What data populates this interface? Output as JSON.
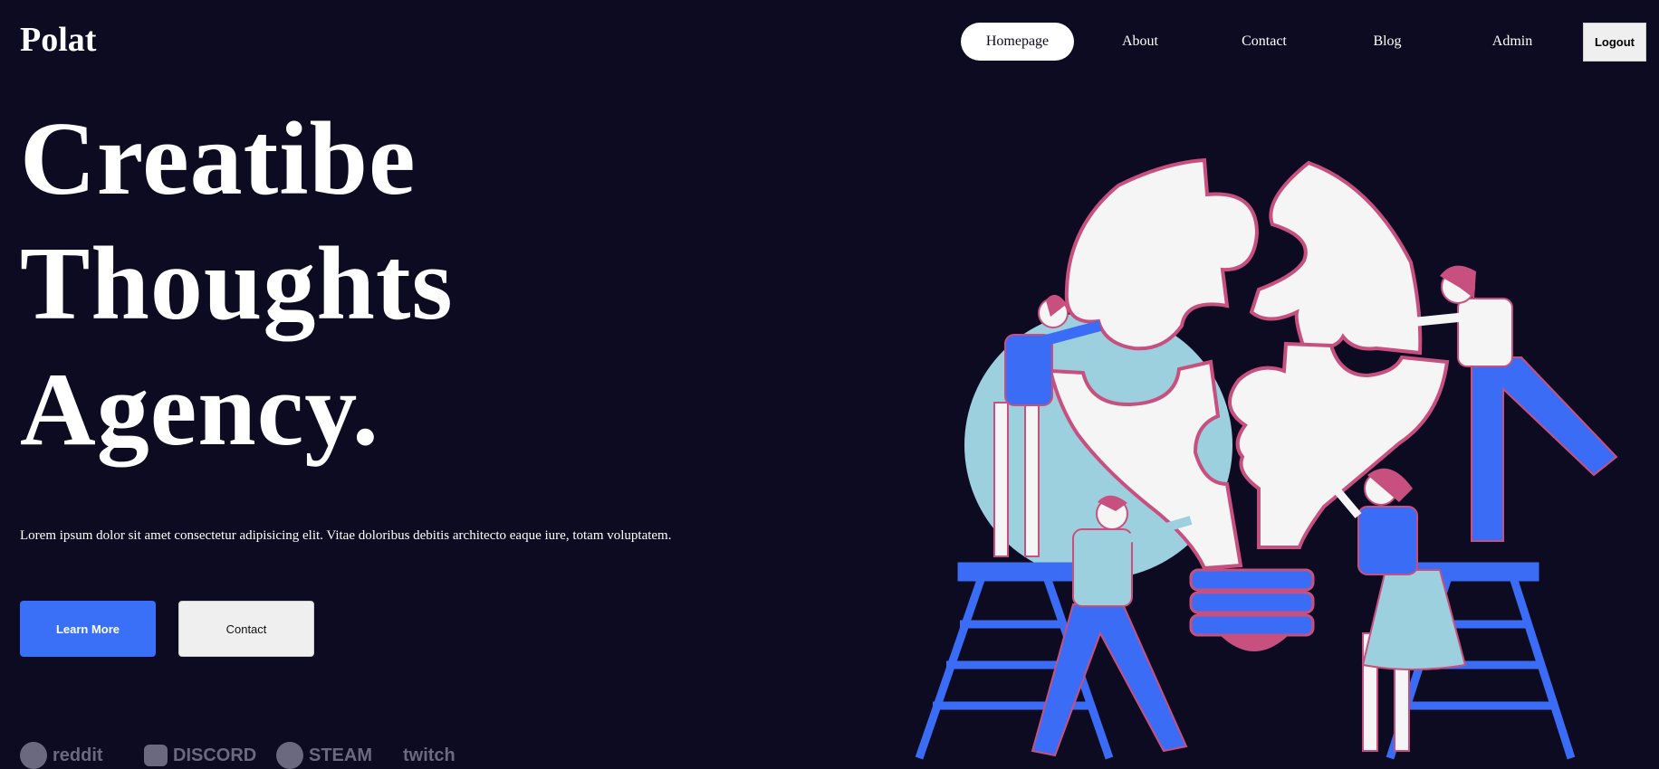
{
  "brand": {
    "logo": "Polat"
  },
  "nav": {
    "items": [
      {
        "label": "Homepage",
        "active": true
      },
      {
        "label": "About",
        "active": false
      },
      {
        "label": "Contact",
        "active": false
      },
      {
        "label": "Blog",
        "active": false
      },
      {
        "label": "Admin",
        "active": false
      }
    ],
    "logout_label": "Logout"
  },
  "hero": {
    "lines": [
      "Creatibe",
      "Thoughts",
      "Agency."
    ],
    "description": "Lorem ipsum dolor sit amet consectetur adipisicing elit. Vitae doloribus debitis architecto eaque iure, totam voluptatem.",
    "primary_button": "Learn More",
    "secondary_button": "Contact"
  },
  "partners": [
    {
      "name": "reddit",
      "icon": "reddit-icon"
    },
    {
      "name": "DISCORD",
      "icon": "discord-icon"
    },
    {
      "name": "STEAM",
      "icon": "steam-icon"
    },
    {
      "name": "twitch",
      "icon": "twitch-icon"
    }
  ],
  "colors": {
    "background": "#0d0b22",
    "accent": "#3a70f7",
    "illustration_pink": "#c8507f",
    "illustration_teal": "#9dd0df",
    "illustration_blue": "#3a6cf5"
  }
}
